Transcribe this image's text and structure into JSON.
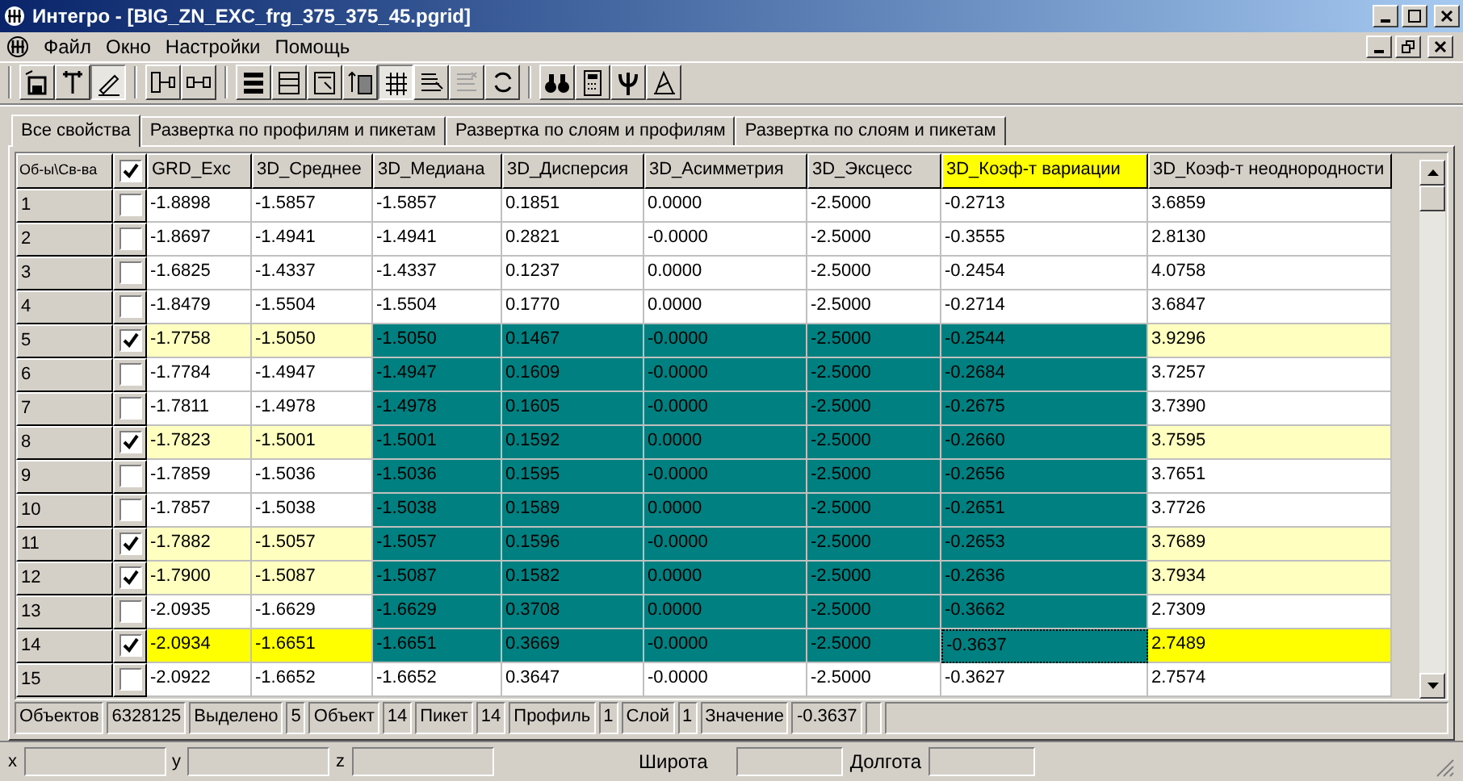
{
  "window": {
    "title": "Интегро - [BIG_ZN_EXC_frg_375_375_45.pgrid]"
  },
  "menu": [
    "Файл",
    "Окно",
    "Настройки",
    "Помощь"
  ],
  "toolbar": [
    {
      "pressed": false,
      "disabled": false
    },
    {
      "pressed": false,
      "disabled": false
    },
    {
      "pressed": true,
      "disabled": false
    },
    {
      "pressed": false,
      "disabled": false
    },
    {
      "pressed": false,
      "disabled": false
    },
    {
      "pressed": false,
      "disabled": false
    },
    {
      "pressed": false,
      "disabled": false
    },
    {
      "pressed": false,
      "disabled": false
    },
    {
      "pressed": false,
      "disabled": false
    },
    {
      "pressed": true,
      "disabled": false
    },
    {
      "pressed": false,
      "disabled": false
    },
    {
      "pressed": false,
      "disabled": true
    },
    {
      "pressed": false,
      "disabled": false
    },
    {
      "pressed": false,
      "disabled": false
    },
    {
      "pressed": false,
      "disabled": false
    },
    {
      "pressed": false,
      "disabled": false
    },
    {
      "pressed": false,
      "disabled": false
    }
  ],
  "tabs": [
    {
      "label": "Все свойства",
      "selected": true
    },
    {
      "label": "Развертка по профилям и пикетам",
      "selected": false
    },
    {
      "label": "Развертка по слоям и профилям",
      "selected": false
    },
    {
      "label": "Развертка по слоям и пикетам",
      "selected": false
    }
  ],
  "table": {
    "corner": "Об-ы\\Св-ва",
    "all_checked": true,
    "columns": [
      {
        "label": "GRD_Exc",
        "highlighted": false,
        "selected": false
      },
      {
        "label": "3D_Среднее",
        "highlighted": false,
        "selected": false
      },
      {
        "label": "3D_Медиана",
        "highlighted": true,
        "selected": false
      },
      {
        "label": "3D_Дисперсия",
        "highlighted": true,
        "selected": false
      },
      {
        "label": "3D_Асимметрия",
        "highlighted": true,
        "selected": false
      },
      {
        "label": "3D_Эксцесс",
        "highlighted": true,
        "selected": false
      },
      {
        "label": "3D_Коэф-т вариации",
        "highlighted": true,
        "selected": true
      },
      {
        "label": "3D_Коэф-т неоднородности",
        "highlighted": false,
        "selected": false
      }
    ],
    "rows": [
      {
        "id": "1",
        "checked": false,
        "highlighted": false,
        "selected": false,
        "cells": [
          "-1.8898",
          "-1.5857",
          "-1.5857",
          "0.1851",
          "0.0000",
          "-2.5000",
          "-0.2713",
          "3.6859"
        ]
      },
      {
        "id": "2",
        "checked": false,
        "highlighted": false,
        "selected": false,
        "cells": [
          "-1.8697",
          "-1.4941",
          "-1.4941",
          "0.2821",
          "-0.0000",
          "-2.5000",
          "-0.3555",
          "2.8130"
        ]
      },
      {
        "id": "3",
        "checked": false,
        "highlighted": false,
        "selected": false,
        "cells": [
          "-1.6825",
          "-1.4337",
          "-1.4337",
          "0.1237",
          "0.0000",
          "-2.5000",
          "-0.2454",
          "4.0758"
        ]
      },
      {
        "id": "4",
        "checked": false,
        "highlighted": false,
        "selected": false,
        "cells": [
          "-1.8479",
          "-1.5504",
          "-1.5504",
          "0.1770",
          "0.0000",
          "-2.5000",
          "-0.2714",
          "3.6847"
        ]
      },
      {
        "id": "5",
        "checked": true,
        "highlighted": true,
        "selected": false,
        "cells": [
          "-1.7758",
          "-1.5050",
          "-1.5050",
          "0.1467",
          "-0.0000",
          "-2.5000",
          "-0.2544",
          "3.9296"
        ]
      },
      {
        "id": "6",
        "checked": false,
        "highlighted": true,
        "selected": false,
        "cells": [
          "-1.7784",
          "-1.4947",
          "-1.4947",
          "0.1609",
          "-0.0000",
          "-2.5000",
          "-0.2684",
          "3.7257"
        ]
      },
      {
        "id": "7",
        "checked": false,
        "highlighted": true,
        "selected": false,
        "cells": [
          "-1.7811",
          "-1.4978",
          "-1.4978",
          "0.1605",
          "-0.0000",
          "-2.5000",
          "-0.2675",
          "3.7390"
        ]
      },
      {
        "id": "8",
        "checked": true,
        "highlighted": true,
        "selected": false,
        "cells": [
          "-1.7823",
          "-1.5001",
          "-1.5001",
          "0.1592",
          "0.0000",
          "-2.5000",
          "-0.2660",
          "3.7595"
        ]
      },
      {
        "id": "9",
        "checked": false,
        "highlighted": true,
        "selected": false,
        "cells": [
          "-1.7859",
          "-1.5036",
          "-1.5036",
          "0.1595",
          "-0.0000",
          "-2.5000",
          "-0.2656",
          "3.7651"
        ]
      },
      {
        "id": "10",
        "checked": false,
        "highlighted": true,
        "selected": false,
        "cells": [
          "-1.7857",
          "-1.5038",
          "-1.5038",
          "0.1589",
          "0.0000",
          "-2.5000",
          "-0.2651",
          "3.7726"
        ]
      },
      {
        "id": "11",
        "checked": true,
        "highlighted": true,
        "selected": false,
        "cells": [
          "-1.7882",
          "-1.5057",
          "-1.5057",
          "0.1596",
          "-0.0000",
          "-2.5000",
          "-0.2653",
          "3.7689"
        ]
      },
      {
        "id": "12",
        "checked": true,
        "highlighted": true,
        "selected": false,
        "cells": [
          "-1.7900",
          "-1.5087",
          "-1.5087",
          "0.1582",
          "0.0000",
          "-2.5000",
          "-0.2636",
          "3.7934"
        ]
      },
      {
        "id": "13",
        "checked": false,
        "highlighted": true,
        "selected": false,
        "cells": [
          "-2.0935",
          "-1.6629",
          "-1.6629",
          "0.3708",
          "0.0000",
          "-2.5000",
          "-0.3662",
          "2.7309"
        ]
      },
      {
        "id": "14",
        "checked": true,
        "highlighted": true,
        "selected": true,
        "cells": [
          "-2.0934",
          "-1.6651",
          "-1.6651",
          "0.3669",
          "-0.0000",
          "-2.5000",
          "-0.3637",
          "2.7489"
        ]
      },
      {
        "id": "15",
        "checked": false,
        "highlighted": false,
        "selected": false,
        "cells": [
          "-2.0922",
          "-1.6652",
          "-1.6652",
          "0.3647",
          "-0.0000",
          "-2.5000",
          "-0.3627",
          "2.7574"
        ]
      }
    ]
  },
  "status_bar": [
    {
      "label": "Объектов",
      "value": "6328125"
    },
    {
      "label": "Выделено",
      "value": "5"
    },
    {
      "label": "Объект",
      "value": "14"
    },
    {
      "label": "Пикет",
      "value": "14"
    },
    {
      "label": "Профиль",
      "value": "1"
    },
    {
      "label": "Слой",
      "value": "1"
    },
    {
      "label": "Значение",
      "value": "-0.3637"
    }
  ],
  "coords": {
    "fields": [
      "x",
      "y",
      "z"
    ],
    "latitude": "Широта",
    "longitude": "Долгота"
  }
}
